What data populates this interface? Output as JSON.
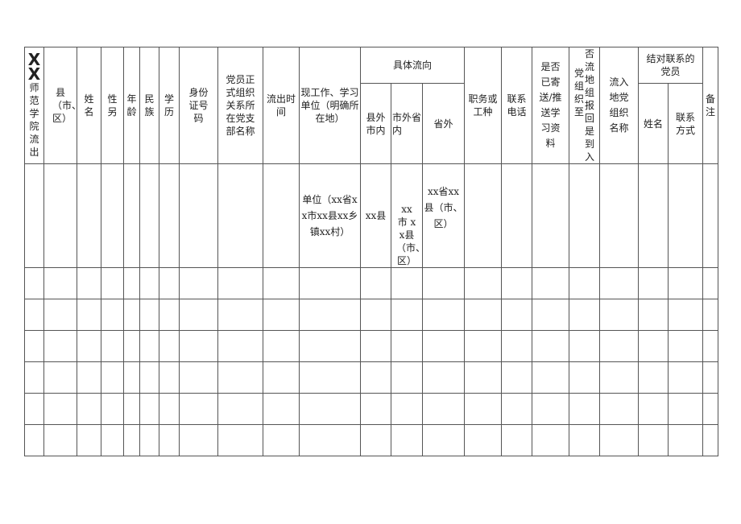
{
  "headers": {
    "c1_mark": "XX",
    "c1": "师范学院流出",
    "c2": "县（市、区）",
    "c3": "姓名",
    "c4": "性另",
    "c5": "年龄",
    "c6": "民族",
    "c7": "学历",
    "c8": "身份证号码",
    "c9": "党员正式组织关系所在党支部名称",
    "c10": "流出时间",
    "c11": "现工作、学习单位（明确所在地）",
    "flow": "具体流向",
    "flow_a": "县外市内",
    "flow_b": "市外省内",
    "flow_c": "省外",
    "c15": "职务或工种",
    "c16": "联系电话",
    "c17": "是否已寄送/推送学习资料",
    "c18a": "党组织至",
    "c18b": "否流地组报回是到入",
    "c19": "流入地党组织名称",
    "pair": "结对联系的党员",
    "pair_a": "姓名",
    "pair_b": "联系方式",
    "c22": "备注"
  },
  "example_row": {
    "unit": "单位（xx省xx市xx县xx乡镇xx村）",
    "flow_a": "xx县",
    "flow_b": "xx 市 xx县（市、区）",
    "flow_c": "xx省xx县（市、区）"
  }
}
